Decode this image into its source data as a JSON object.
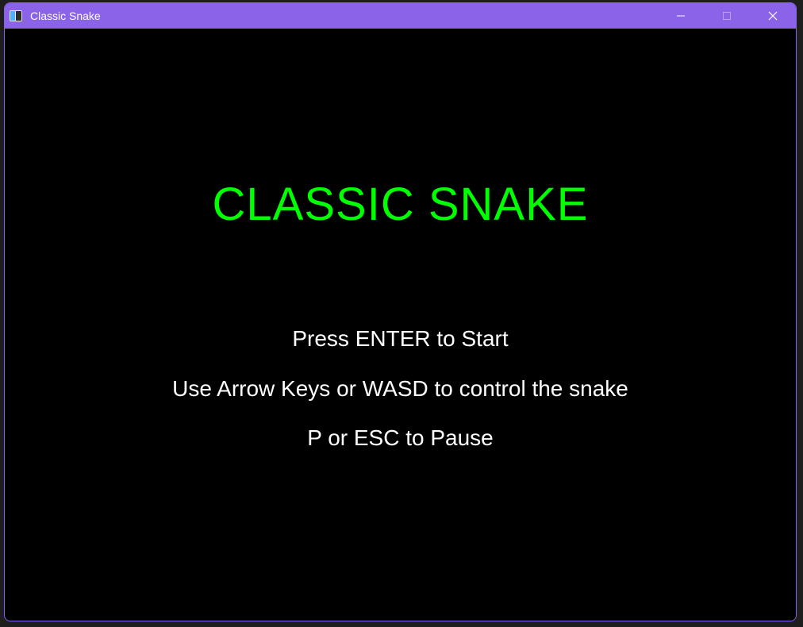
{
  "window": {
    "title": "Classic Snake",
    "accent_color": "#8a63e8",
    "controls": {
      "minimize_icon": "minimize-icon",
      "maximize_icon": "maximize-icon",
      "close_icon": "close-icon"
    }
  },
  "game": {
    "title": "CLASSIC SNAKE",
    "title_color": "#00ff00",
    "instructions": [
      "Press ENTER to Start",
      "Use Arrow Keys or WASD to control the snake",
      "P or ESC to Pause"
    ]
  }
}
